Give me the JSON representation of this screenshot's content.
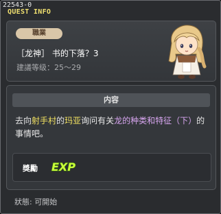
{
  "window": {
    "quest_id": "22543-0",
    "title": "QUEST INFO"
  },
  "quest": {
    "job_badge": "職業",
    "name": "［龙神］ 书的下落？3",
    "level": "建議等级：25～29"
  },
  "content": {
    "header": "内容",
    "description_parts": [
      {
        "text": "去向",
        "style": "normal"
      },
      {
        "text": "射手村",
        "style": "yellow"
      },
      {
        "text": "的",
        "style": "normal"
      },
      {
        "text": "玛亚",
        "style": "yellow"
      },
      {
        "text": "询问有关",
        "style": "normal"
      },
      {
        "text": "龙的种类和特征（下）",
        "style": "purple"
      },
      {
        "text": "的事情吧。",
        "style": "normal"
      }
    ]
  },
  "reward": {
    "label": "獎勵",
    "exp_text": "EXP"
  },
  "status": "狀態:  可開始",
  "icons": {
    "npc": "npc-girl-portrait",
    "exp": "exp-reward-icon"
  }
}
